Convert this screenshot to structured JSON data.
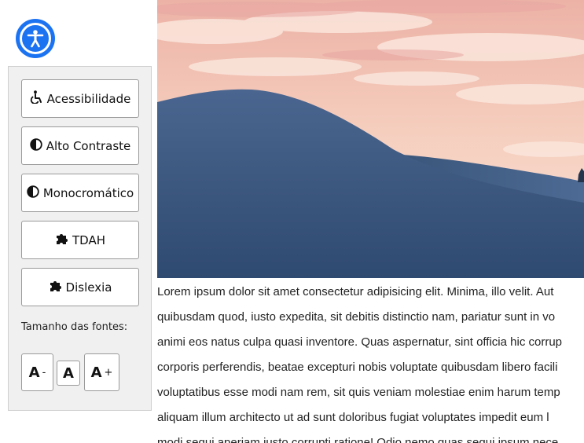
{
  "accessibility_toggle": {
    "icon": "accessibility-icon",
    "color": "#1c73f2"
  },
  "panel": {
    "buttons": [
      {
        "label": "Acessibilidade",
        "icon": "wheelchair-icon"
      },
      {
        "label": "Alto Contraste",
        "icon": "contrast-icon"
      },
      {
        "label": "Monocromático",
        "icon": "contrast-icon"
      },
      {
        "label": "TDAH",
        "icon": "puzzle-icon"
      },
      {
        "label": "Dislexia",
        "icon": "puzzle-icon"
      }
    ],
    "font_size_label": "Tamanho das fontes:",
    "font_buttons": [
      {
        "letter": "A",
        "symbol": "-"
      },
      {
        "letter": "A",
        "symbol": ""
      },
      {
        "letter": "A",
        "symbol": "+"
      }
    ]
  },
  "hero": {
    "description_colors": {
      "sky": "#f3c9b8",
      "dune": "#3d587f"
    }
  },
  "article": {
    "lines": [
      "Lorem ipsum dolor sit amet consectetur adipisicing elit. Minima, illo velit. Aut",
      "quibusdam quod, iusto expedita, sit debitis distinctio nam, pariatur sunt in vo",
      "animi eos natus culpa quasi inventore. Quas aspernatur, sint officia hic corrup",
      "corporis perferendis, beatae excepturi nobis voluptate quibusdam libero facili",
      "voluptatibus esse modi nam rem, sit quis veniam molestiae enim harum temp",
      "aliquam illum architecto ut ad sunt doloribus fugiat voluptates impedit eum l",
      "modi sequi aperiam iusto corrupti ratione! Odio nemo quas sequi ipsum nece"
    ]
  }
}
